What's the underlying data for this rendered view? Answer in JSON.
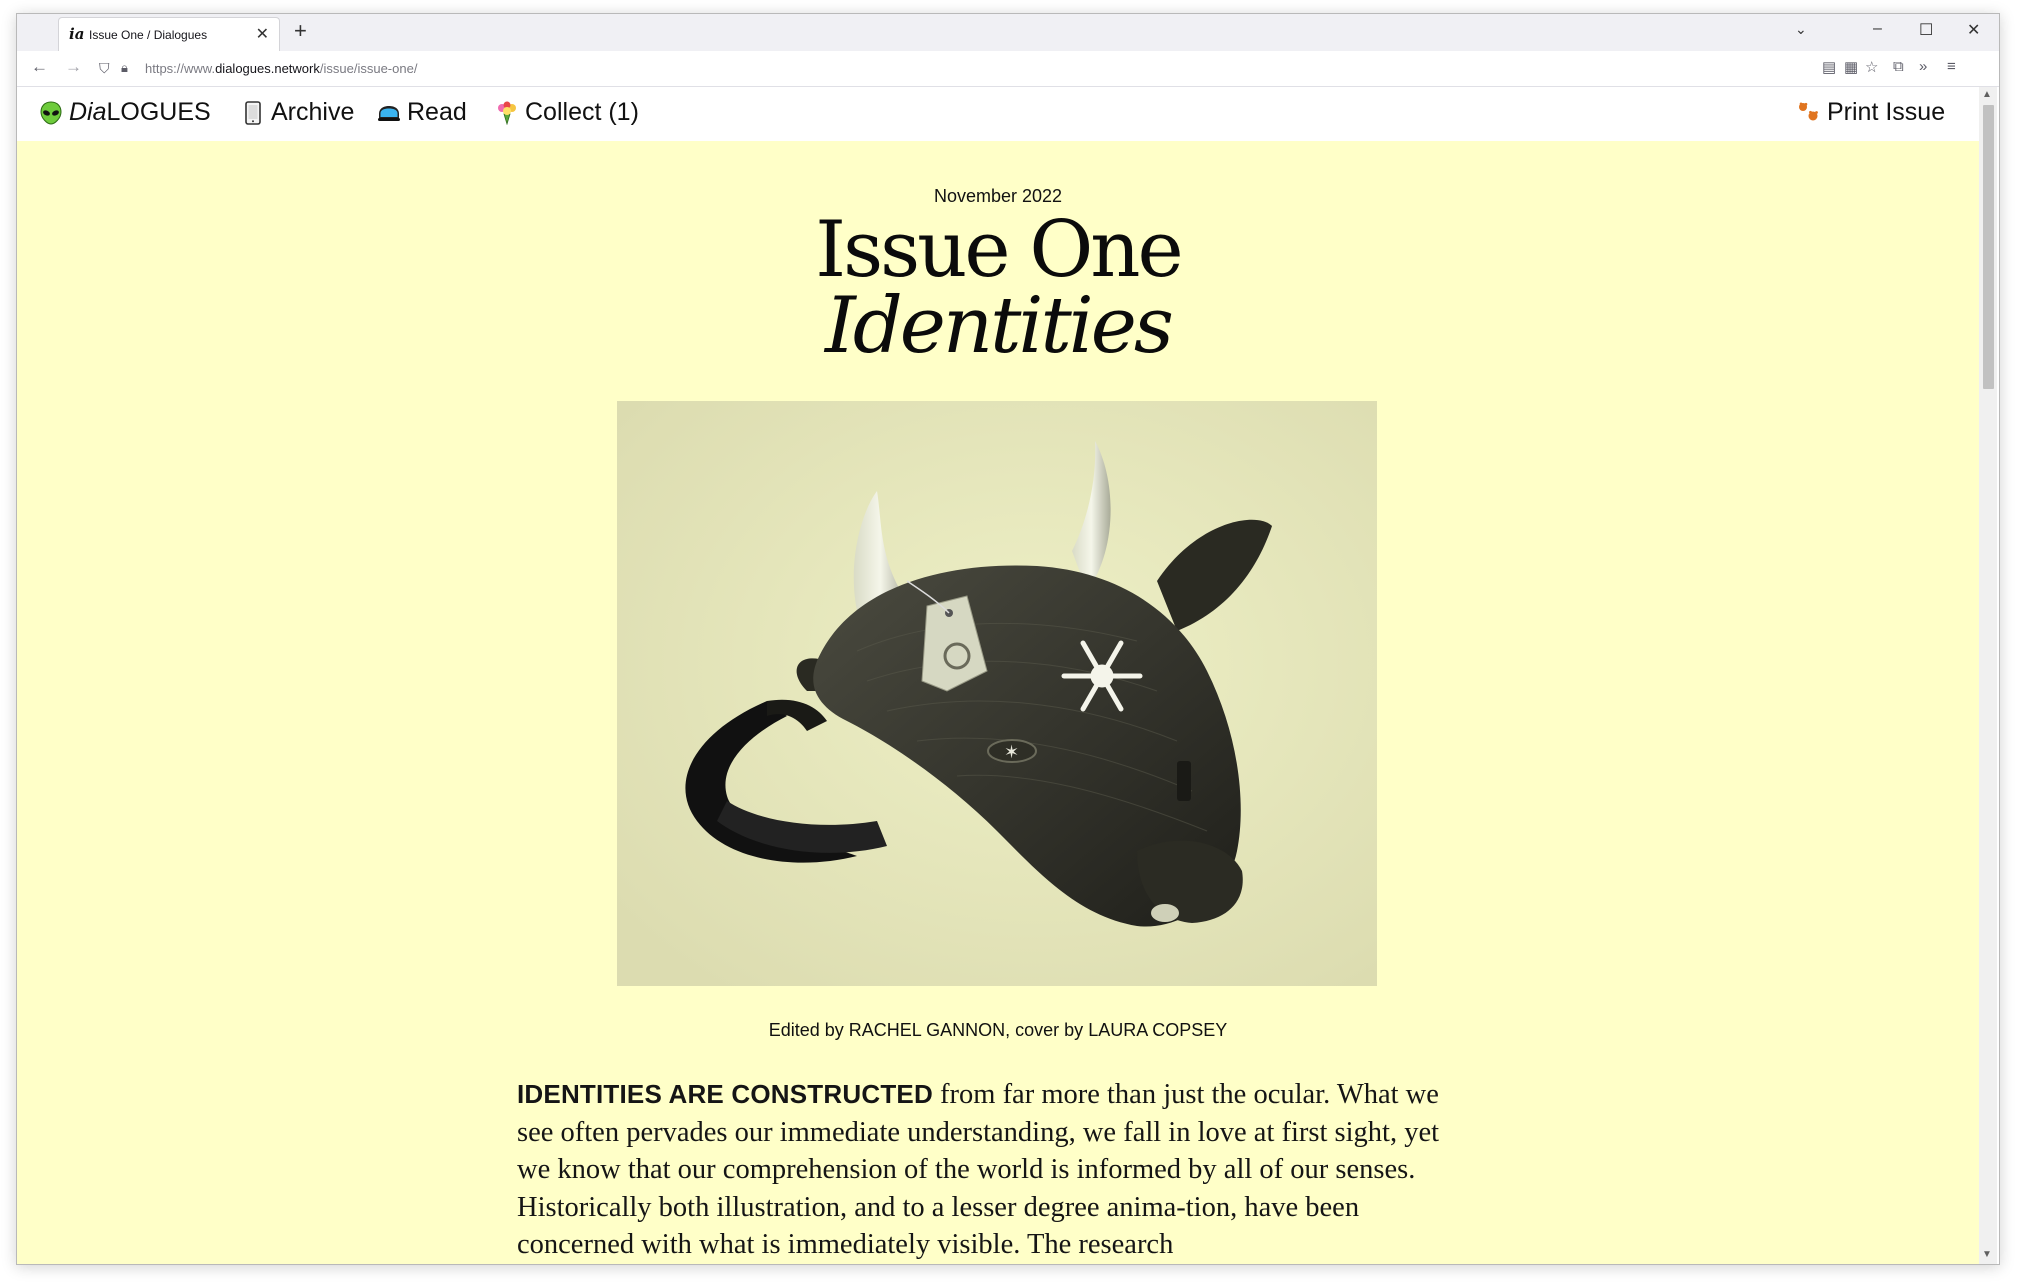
{
  "browser": {
    "tab_title": "Issue One / Dialogues",
    "tab_favicon": "ia",
    "url_scheme": "https://www.",
    "url_host": "dialogues.network",
    "url_path": "/issue/issue-one/"
  },
  "site_nav": {
    "logo_prefix": "Dia",
    "logo_suffix": "LOGUES",
    "archive": "Archive",
    "read": "Read",
    "collect": "Collect (1)",
    "print": "Print Issue"
  },
  "issue": {
    "date": "November 2022",
    "title": "Issue One",
    "subtitle": "Identities",
    "cover_image_alt": "black straw bull mask with silver horns, tag and snowflake ornament",
    "credits_prefix": "Edited by ",
    "editor": "RACHEL GANNON",
    "credits_mid": ", cover by ",
    "illustrator": "LAURA COPSEY",
    "intro_lead": "IDENTITIES ARE CONSTRUCTED",
    "intro_text": " from far more than just the ocular. What we see often pervades our immediate understanding, we fall in love at first sight, yet we know that our comprehension of the world is informed by all of our senses. Historically both illustration, and to a lesser degree anima-tion, have been concerned with what is immediately visible. The research"
  },
  "colors": {
    "page_bg": "#ffffc8",
    "header_bg": "#ffffff",
    "text": "#111111"
  },
  "icons": {
    "logo": "alien-icon",
    "archive": "phone-icon",
    "read": "goggles-icon",
    "collect": "bouquet-icon",
    "print": "paw-prints-icon"
  }
}
